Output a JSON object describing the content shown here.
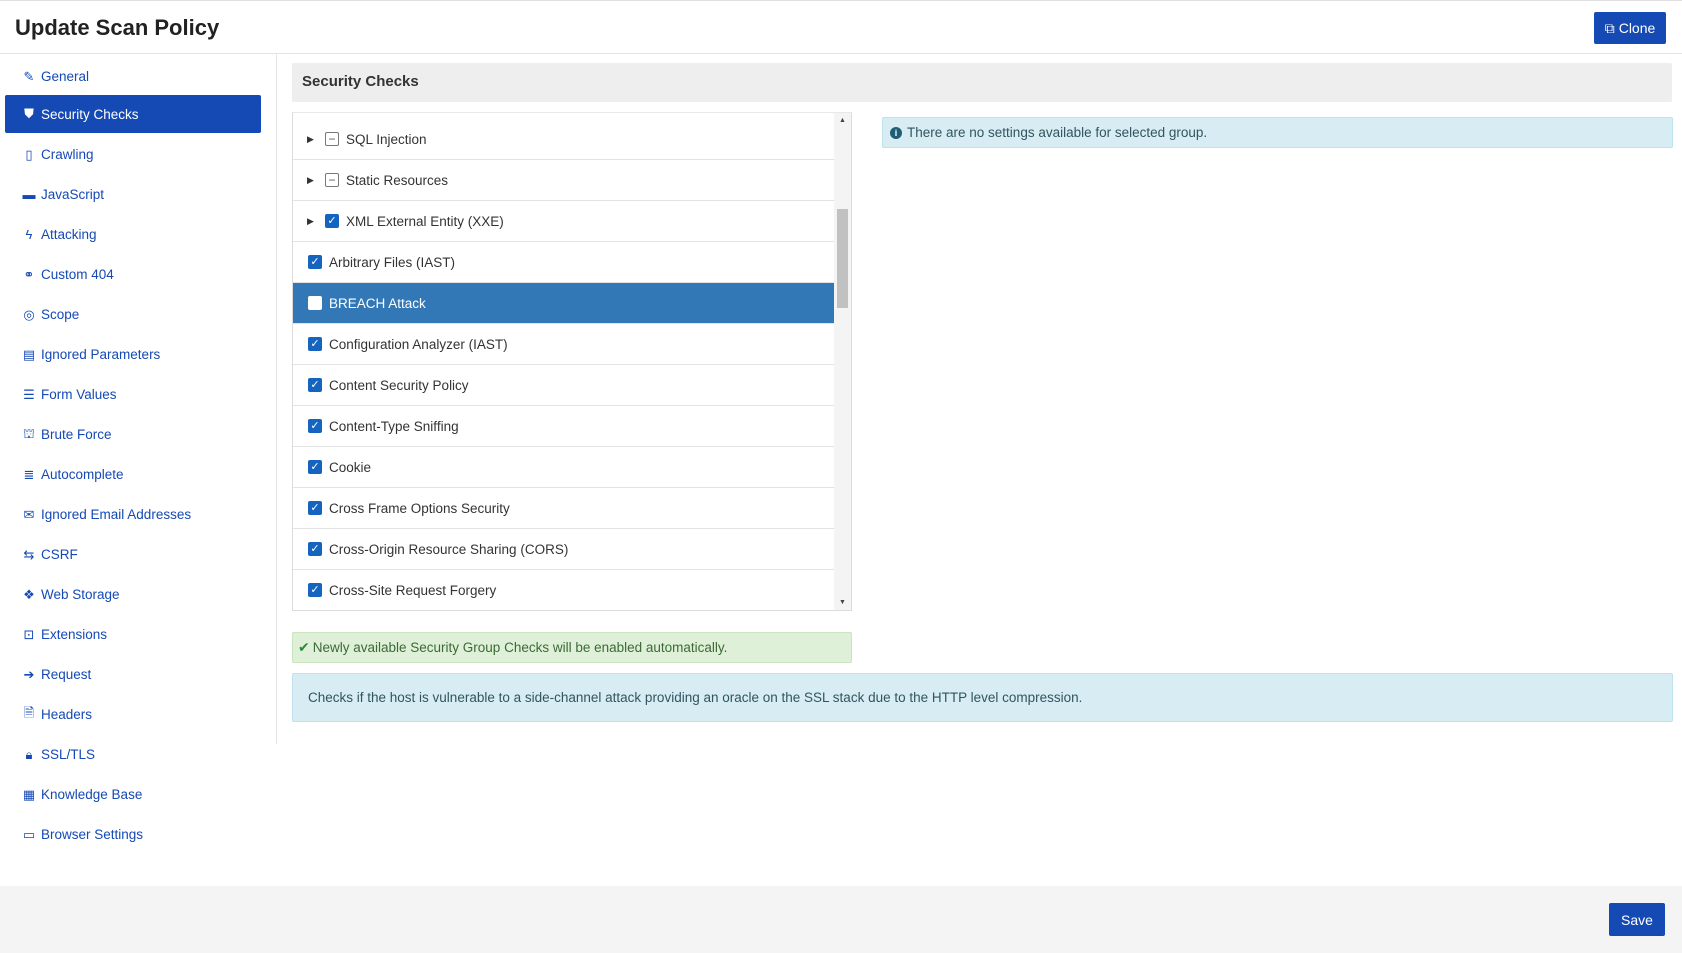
{
  "header": {
    "title": "Update Scan Policy",
    "clone_label": "Clone"
  },
  "sidebar": {
    "items": [
      {
        "label": "General",
        "icon": "edit-icon"
      },
      {
        "label": "Security Checks",
        "icon": "shield-icon",
        "active": true
      },
      {
        "label": "Crawling",
        "icon": "file-icon"
      },
      {
        "label": "JavaScript",
        "icon": "print-icon"
      },
      {
        "label": "Attacking",
        "icon": "bolt-icon"
      },
      {
        "label": "Custom 404",
        "icon": "link-icon"
      },
      {
        "label": "Scope",
        "icon": "crosshair-icon"
      },
      {
        "label": "Ignored Parameters",
        "icon": "table-icon"
      },
      {
        "label": "Form Values",
        "icon": "list-icon"
      },
      {
        "label": "Brute Force",
        "icon": "lock-icon"
      },
      {
        "label": "Autocomplete",
        "icon": "list-lines-icon"
      },
      {
        "label": "Ignored Email Addresses",
        "icon": "envelope-icon"
      },
      {
        "label": "CSRF",
        "icon": "shuffle-icon"
      },
      {
        "label": "Web Storage",
        "icon": "cubes-icon"
      },
      {
        "label": "Extensions",
        "icon": "puzzle-icon"
      },
      {
        "label": "Request",
        "icon": "arrow-right-icon"
      },
      {
        "label": "Headers",
        "icon": "document-icon"
      },
      {
        "label": "SSL/TLS",
        "icon": "padlock-icon"
      },
      {
        "label": "Knowledge Base",
        "icon": "cube-icon"
      },
      {
        "label": "Browser Settings",
        "icon": "window-icon"
      }
    ]
  },
  "main": {
    "section_title": "Security Checks",
    "checks": [
      {
        "label": "SQL Injection",
        "state": "partial",
        "group": true
      },
      {
        "label": "Static Resources",
        "state": "partial",
        "group": true
      },
      {
        "label": "XML External Entity (XXE)",
        "state": "checked",
        "group": true
      },
      {
        "label": "Arbitrary Files (IAST)",
        "state": "checked",
        "group": false
      },
      {
        "label": "BREACH Attack",
        "state": "unchecked",
        "group": false,
        "selected": true
      },
      {
        "label": "Configuration Analyzer (IAST)",
        "state": "checked",
        "group": false
      },
      {
        "label": "Content Security Policy",
        "state": "checked",
        "group": false
      },
      {
        "label": "Content-Type Sniffing",
        "state": "checked",
        "group": false
      },
      {
        "label": "Cookie",
        "state": "checked",
        "group": false
      },
      {
        "label": "Cross Frame Options Security",
        "state": "checked",
        "group": false
      },
      {
        "label": "Cross-Origin Resource Sharing (CORS)",
        "state": "checked",
        "group": false
      },
      {
        "label": "Cross-Site Request Forgery",
        "state": "checked",
        "group": false
      }
    ],
    "info_message": "There are no settings available for selected group.",
    "success_message": "Newly available Security Group Checks will be enabled automatically.",
    "description": "Checks if the host is vulnerable to a side-channel attack providing an oracle on the SSL stack due to the HTTP level compression."
  },
  "footer": {
    "save_label": "Save"
  },
  "colors": {
    "accent": "#1549b4",
    "selected_row": "#3277b6",
    "info_bg": "#d8edf3",
    "success_bg": "#dff0d8"
  }
}
